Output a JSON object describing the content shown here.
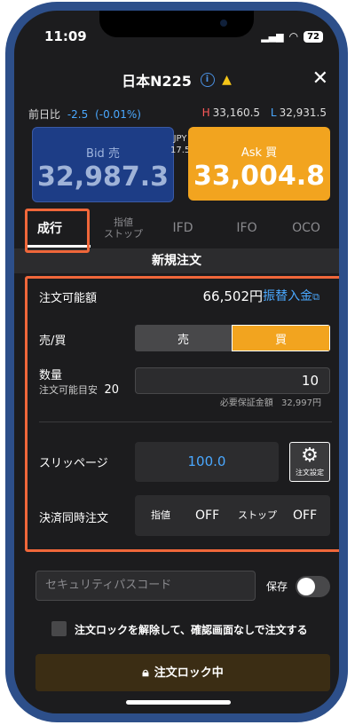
{
  "status": {
    "time": "11:09",
    "battery": "72"
  },
  "header": {
    "title": "日本N225"
  },
  "quote": {
    "prev_label": "前日比",
    "change": "-2.5",
    "change_pct": "(-0.01%)",
    "high_label": "H",
    "high": "33,160.5",
    "low_label": "L",
    "low": "32,931.5"
  },
  "bid": {
    "label": "Bid 売",
    "price": "32,987.3"
  },
  "ask": {
    "label": "Ask 買",
    "price": "33,004.8"
  },
  "spread": {
    "currency": "JPY",
    "value": "17.5"
  },
  "tabs": [
    {
      "label": "成行"
    },
    {
      "label": "指値\nストップ"
    },
    {
      "label": "IFD"
    },
    {
      "label": "IFO"
    },
    {
      "label": "OCO"
    }
  ],
  "section_title": "新規注文",
  "form": {
    "available_label": "注文可能額",
    "available_value": "66,502円",
    "transfer_label": "振替入金",
    "side_label": "売/買",
    "sell_label": "売",
    "buy_label": "買",
    "qty_label": "数量",
    "qty_hint_label": "注文可能目安",
    "qty_hint_value": "20",
    "qty_value": "10",
    "margin_label": "必要保証金額",
    "margin_value": "32,997円",
    "slippage_label": "スリッページ",
    "slippage_value": "100.0",
    "settings_label": "注文設定",
    "settle_label": "決済同時注文",
    "limit_label": "指値",
    "limit_value": "OFF",
    "stop_label": "ストップ",
    "stop_value": "OFF"
  },
  "security": {
    "placeholder": "セキュリティパスコード",
    "save_label": "保存"
  },
  "unlock_label": "注文ロックを解除して、確認画面なしで注文する",
  "lock_button": "注文ロック中",
  "colors": {
    "accent": "#f2a41f",
    "bid": "#1d3d86",
    "highlight": "#f0673a",
    "link": "#4aa8ff"
  }
}
